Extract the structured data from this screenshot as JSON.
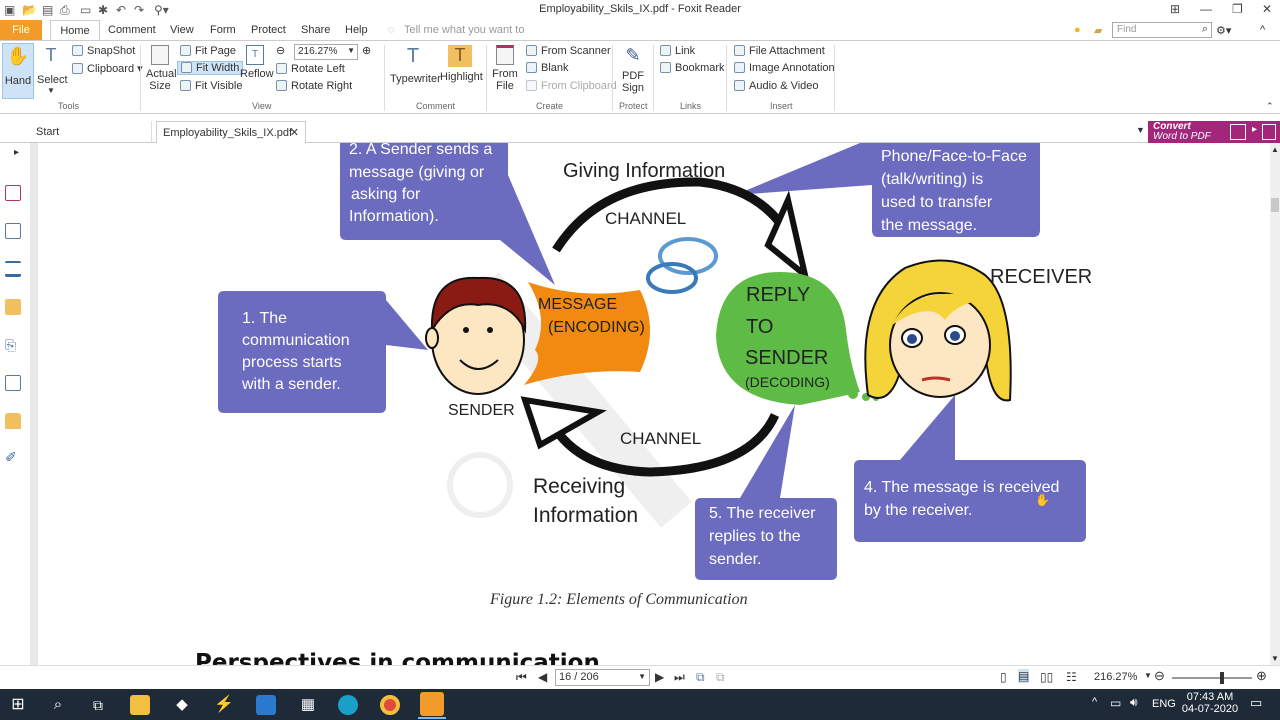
{
  "window": {
    "title": "Employability_Skils_IX.pdf - Foxit Reader"
  },
  "menu": {
    "file": "File",
    "home": "Home",
    "comment": "Comment",
    "view": "View",
    "form": "Form",
    "protect": "Protect",
    "share": "Share",
    "help": "Help",
    "tellme": "Tell me what you want to",
    "find_placeholder": "Find"
  },
  "ribbon": {
    "hand": "Hand",
    "select": "Select",
    "snapshot": "SnapShot",
    "clipboard": "Clipboard",
    "actual_size_1": "Actual",
    "actual_size_2": "Size",
    "fit_page": "Fit Page",
    "fit_width": "Fit Width",
    "fit_visible": "Fit Visible",
    "reflow": "Reflow",
    "zoom": "216.27%",
    "rotate_left": "Rotate Left",
    "rotate_right": "Rotate Right",
    "typewriter": "Typewriter",
    "highlight": "Highlight",
    "from_file_1": "From",
    "from_file_2": "File",
    "from_scanner": "From Scanner",
    "blank": "Blank",
    "from_clipboard": "From Clipboard",
    "pdf_sign_1": "PDF",
    "pdf_sign_2": "Sign",
    "link": "Link",
    "bookmark": "Bookmark",
    "file_attachment": "File Attachment",
    "image_annotation": "Image Annotation",
    "audio_video": "Audio & Video",
    "groups": {
      "tools": "Tools",
      "view": "View",
      "comment": "Comment",
      "create": "Create",
      "protect": "Protect",
      "links": "Links",
      "insert": "Insert"
    }
  },
  "tabs": {
    "start": "Start",
    "doc": "Employability_Skils_IX.pdf",
    "convert_1": "Convert",
    "convert_2": "Word to PDF"
  },
  "diagram": {
    "callout2": [
      "2. A Sender sends a",
      "message (giving or",
      "asking for",
      "Information)."
    ],
    "giving": "Giving Information",
    "callout3": [
      "Phone/Face-to-Face",
      "(talk/writing) is",
      "used to transfer",
      "the message."
    ],
    "channel_top": "CHANNEL",
    "channel_bottom": "CHANNEL",
    "message": [
      "MESSAGE",
      "(ENCODING)"
    ],
    "reply": [
      "REPLY",
      "TO",
      "SENDER",
      "(DECODING)"
    ],
    "receiver": "RECEIVER",
    "sender": "SENDER",
    "callout1": [
      "1. The",
      "communication",
      "process starts",
      "with a sender."
    ],
    "receiving": [
      "Receiving",
      "Information"
    ],
    "callout4": [
      "4. The message is received",
      "by the receiver."
    ],
    "callout5": [
      "5. The receiver",
      "replies to the",
      "sender."
    ],
    "caption": "Figure 1.2: Elements of Communication",
    "heading": "Perspectives in communication"
  },
  "status": {
    "page": "16 / 206",
    "zoom": "216.27%"
  },
  "taskbar": {
    "lang": "ENG",
    "time": "07:43 AM",
    "date": "04-07-2020"
  }
}
